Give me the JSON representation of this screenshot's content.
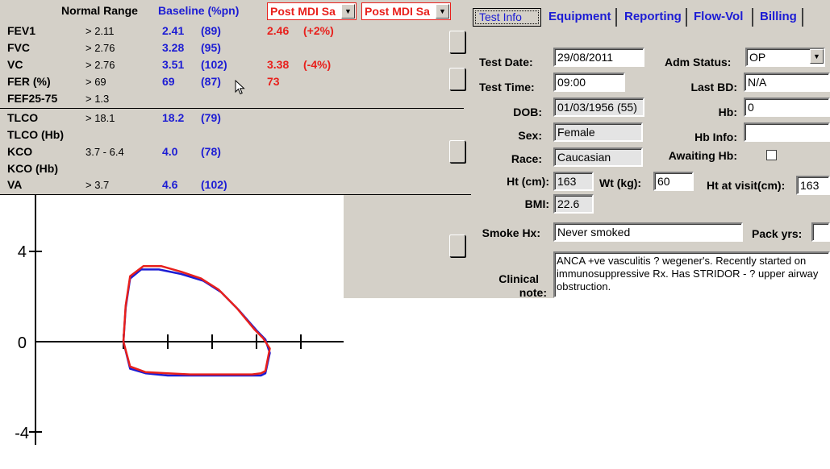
{
  "results": {
    "headers": {
      "normal_range": "Normal Range",
      "baseline": "Baseline (%pn)",
      "post1": "Post MDI Sa",
      "post2": "Post MDI Sa"
    },
    "rows": [
      {
        "label": "FEV1",
        "range": "> 2.11",
        "base": "2.41",
        "pct": "(89)",
        "post": "2.46",
        "change": "(+2%)"
      },
      {
        "label": "FVC",
        "range": "> 2.76",
        "base": "3.28",
        "pct": "(95)",
        "post": "",
        "change": ""
      },
      {
        "label": "VC",
        "range": "> 2.76",
        "base": "3.51",
        "pct": "(102)",
        "post": "3.38",
        "change": "(-4%)"
      },
      {
        "label": "FER  (%)",
        "range": "> 69",
        "base": "69",
        "pct": "(87)",
        "post": "73",
        "change": ""
      },
      {
        "label": "FEF25-75",
        "range": "> 1.3",
        "base": "",
        "pct": "",
        "post": "",
        "change": ""
      },
      {
        "label": "TLCO",
        "range": "> 18.1",
        "base": "18.2",
        "pct": "(79)",
        "post": "",
        "change": ""
      },
      {
        "label": "TLCO (Hb)",
        "range": "",
        "base": "",
        "pct": "",
        "post": "",
        "change": ""
      },
      {
        "label": "KCO",
        "range": "3.7 - 6.4",
        "base": "4.0",
        "pct": "(78)",
        "post": "",
        "change": ""
      },
      {
        "label": "KCO (Hb)",
        "range": "",
        "base": "",
        "pct": "",
        "post": "",
        "change": ""
      },
      {
        "label": "VA",
        "range": "> 3.7",
        "base": "4.6",
        "pct": "(102)",
        "post": "",
        "change": ""
      }
    ]
  },
  "tabs": [
    "Test Info",
    "Equipment",
    "Reporting",
    "Flow-Vol",
    "Billing"
  ],
  "form": {
    "test_date": {
      "label": "Test Date:",
      "value": "29/08/2011"
    },
    "test_time": {
      "label": "Test Time:",
      "value": "09:00"
    },
    "dob": {
      "label": "DOB:",
      "value": "01/03/1956 (55)"
    },
    "sex": {
      "label": "Sex:",
      "value": "Female"
    },
    "race": {
      "label": "Race:",
      "value": "Caucasian"
    },
    "ht": {
      "label": "Ht (cm):",
      "value": "163"
    },
    "wt": {
      "label": "Wt (kg):",
      "value": "60"
    },
    "ht_visit": {
      "label": "Ht at visit(cm):",
      "value": "163"
    },
    "bmi": {
      "label": "BMI:",
      "value": "22.6"
    },
    "adm_status": {
      "label": "Adm Status:",
      "value": "OP"
    },
    "last_bd": {
      "label": "Last BD:",
      "value": "N/A"
    },
    "hb": {
      "label": "Hb:",
      "value": "0"
    },
    "hb_info": {
      "label": "Hb Info:",
      "value": ""
    },
    "awaiting_hb": {
      "label": "Awaiting Hb:",
      "checked": false
    },
    "smoke_hx": {
      "label": "Smoke Hx:",
      "value": "Never smoked"
    },
    "pack_yrs": {
      "label": "Pack yrs:",
      "value": ""
    },
    "clinical_note": {
      "label1": "Clinical",
      "label2": "note:",
      "value": "ANCA +ve vasculitis ? wegener's. Recently started on immunosuppressive Rx. Has STRIDOR - ? upper airway obstruction."
    }
  },
  "chart_data": {
    "type": "line",
    "title": "",
    "xlabel": "",
    "ylabel": "",
    "y_ticks": [
      "4",
      "0",
      "-4"
    ],
    "x_ticks": [
      0,
      1,
      2,
      3,
      4
    ],
    "xlim": [
      -1.8,
      4.2
    ],
    "ylim": [
      -5,
      6
    ],
    "grid": false,
    "series": [
      {
        "color": "#1c1cd4",
        "x": [
          0,
          0.05,
          0.15,
          0.4,
          0.8,
          1.3,
          1.8,
          2.2,
          2.6,
          3.0,
          3.2,
          3.3,
          3.2,
          3.1,
          2.9,
          2.5,
          2.0,
          1.5,
          1.0,
          0.5,
          0.15,
          0
        ],
        "y": [
          0,
          1.5,
          2.8,
          3.2,
          3.2,
          3.0,
          2.7,
          2.2,
          1.4,
          0.5,
          0.1,
          -0.5,
          -1.4,
          -1.5,
          -1.5,
          -1.5,
          -1.5,
          -1.5,
          -1.5,
          -1.4,
          -1.2,
          0
        ]
      },
      {
        "color": "#e8201c",
        "x": [
          0,
          0.05,
          0.15,
          0.45,
          0.85,
          1.3,
          1.75,
          2.15,
          2.55,
          2.95,
          3.15,
          3.3,
          3.2,
          3.1,
          2.9,
          2.5,
          2.0,
          1.5,
          1.0,
          0.5,
          0.15,
          0
        ],
        "y": [
          0,
          1.6,
          2.9,
          3.35,
          3.35,
          3.1,
          2.8,
          2.3,
          1.5,
          0.55,
          0.15,
          -0.3,
          -1.3,
          -1.4,
          -1.45,
          -1.45,
          -1.45,
          -1.45,
          -1.4,
          -1.35,
          -1.1,
          0
        ]
      }
    ]
  }
}
